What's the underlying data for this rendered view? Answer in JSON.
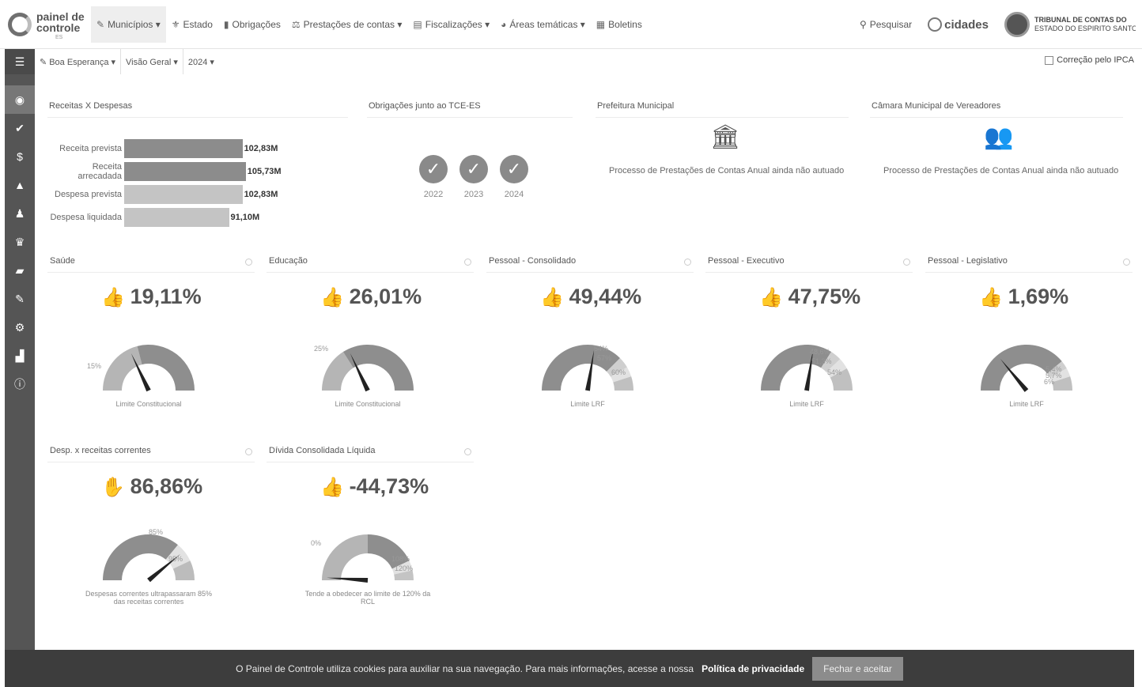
{
  "brand": {
    "line1": "painel de",
    "line2": "controle",
    "sub": "ES"
  },
  "nav": [
    {
      "label": "Municípios ▾",
      "icon": "✎",
      "active": true
    },
    {
      "label": "Estado",
      "icon": "⚜"
    },
    {
      "label": "Obrigações",
      "icon": "▮"
    },
    {
      "label": "Prestações de contas ▾",
      "icon": "⚖"
    },
    {
      "label": "Fiscalizações ▾",
      "icon": "▤"
    },
    {
      "label": "Áreas temáticas ▾",
      "icon": "◕"
    },
    {
      "label": "Boletins",
      "icon": "▦"
    }
  ],
  "search_label": "Pesquisar",
  "cidades_label": "cidades",
  "tce": {
    "line1": "TRIBUNAL DE CONTAS DO",
    "line2": "ESTADO DO ESPIRITO SANTO"
  },
  "subbar": {
    "municipio": "Boa Esperança ▾",
    "view": "Visão Geral ▾",
    "year": "2024 ▾",
    "ipca_label": "Correção pelo IPCA"
  },
  "sidebar_icons": [
    "menu-icon",
    "eye-icon",
    "check-icon",
    "dollar-icon",
    "warning-icon",
    "person-icon",
    "trophy-icon",
    "book-icon",
    "edit-icon",
    "gear-icon",
    "bar-chart-icon",
    "info-icon"
  ],
  "panels": {
    "receitas_title": "Receitas X Despesas",
    "obrigacoes_title": "Obrigações junto ao TCE-ES",
    "prefeitura_title": "Prefeitura Municipal",
    "camara_title": "Câmara Municipal de Vereadores",
    "prefeitura_text": "Processo de Prestações de Contas Anual ainda não autuado",
    "camara_text": "Processo de Prestações de Contas Anual ainda não autuado"
  },
  "chart_data": {
    "type": "bar",
    "orientation": "horizontal",
    "categories": [
      "Receita prevista",
      "Receita arrecadada",
      "Despesa prevista",
      "Despesa liquidada"
    ],
    "values": [
      102.83,
      105.73,
      102.83,
      91.1
    ],
    "value_labels": [
      "102,83M",
      "105,73M",
      "102,83M",
      "91,10M"
    ],
    "colors": [
      "#8c8c8c",
      "#8c8c8c",
      "#c4c4c4",
      "#c4c4c4"
    ]
  },
  "obligations": [
    {
      "year": "2022",
      "status": "ok"
    },
    {
      "year": "2023",
      "status": "ok"
    },
    {
      "year": "2024",
      "status": "ok"
    }
  ],
  "gauges": [
    {
      "title": "Saúde",
      "value": "19,11%",
      "pct": 19.11,
      "thumb": "up",
      "ticks": [
        "15%"
      ],
      "caption": "Limite Constitucional"
    },
    {
      "title": "Educação",
      "value": "26,01%",
      "pct": 26.01,
      "thumb": "up",
      "ticks": [
        "25%"
      ],
      "caption": "Limite Constitucional"
    },
    {
      "title": "Pessoal - Consolidado",
      "value": "49,44%",
      "pct": 49.44,
      "thumb": "up",
      "ticks": [
        "54%",
        "57%",
        "60%"
      ],
      "caption": "Limite LRF"
    },
    {
      "title": "Pessoal - Executivo",
      "value": "47,75%",
      "pct": 47.75,
      "thumb": "up",
      "ticks": [
        "48,6%",
        "51,3%",
        "54%"
      ],
      "caption": "Limite LRF"
    },
    {
      "title": "Pessoal - Legislativo",
      "value": "1,69%",
      "pct": 1.69,
      "thumb": "up",
      "ticks": [
        "5,4%",
        "5,7%",
        "6%"
      ],
      "caption": "Limite LRF"
    },
    {
      "title": "Desp. x receitas correntes",
      "value": "86,86%",
      "pct": 86.86,
      "thumb": "down",
      "ticks": [
        "85%",
        "95%"
      ],
      "caption": "Despesas correntes ultrapassaram 85% das receitas correntes"
    },
    {
      "title": "Dívida Consolidada Líquida",
      "value": "-44,73%",
      "pct": -44.73,
      "thumb": "up",
      "ticks": [
        "0%",
        "108%",
        "120%"
      ],
      "caption": "Tende a obedecer ao limite de 120% da RCL"
    }
  ],
  "cookie": {
    "text": "O Painel de Controle utiliza cookies para auxiliar na sua navegação. Para mais informações, acesse a nossa",
    "link": "Política de privacidade",
    "button": "Fechar e aceitar"
  }
}
